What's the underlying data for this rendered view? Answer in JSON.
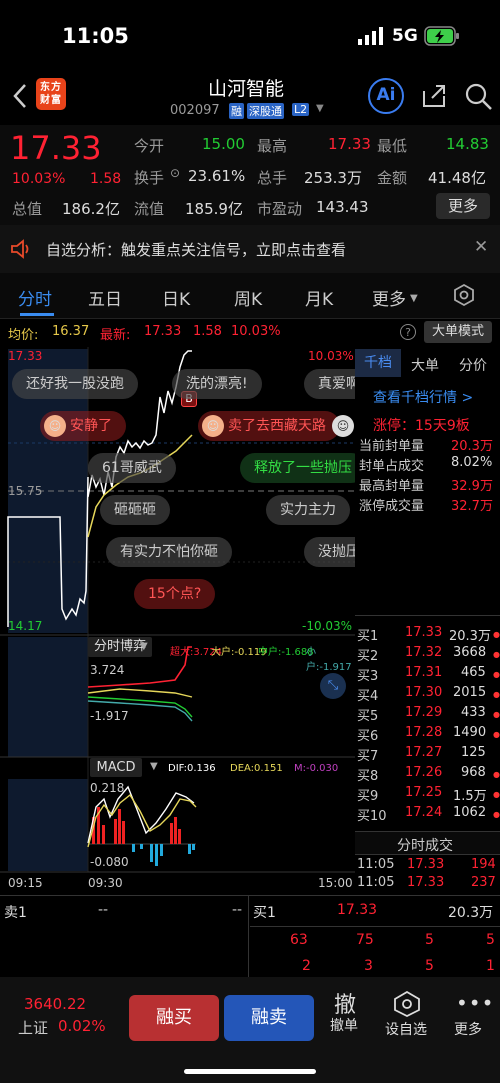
{
  "status_bar": {
    "time": "11:05",
    "network": "5G"
  },
  "header": {
    "brand_logo_text": "东方财富",
    "title": "山河智能",
    "code": "002097",
    "tags": [
      "融",
      "深股通",
      "L2"
    ],
    "ai_label": "Ai"
  },
  "quote": {
    "price": "17.33",
    "change_pct": "10.03%",
    "change_amt": "1.58",
    "fields": [
      {
        "label": "今开",
        "value": "15.00",
        "color": "#2c3"
      },
      {
        "label": "最高",
        "value": "17.33",
        "color": "#f23"
      },
      {
        "label": "最低",
        "value": "14.83",
        "color": "#2c3"
      },
      {
        "label": "换手",
        "value": "23.61%",
        "color": "#ddd"
      },
      {
        "label": "总手",
        "value": "253.3万",
        "color": "#ddd"
      },
      {
        "label": "金额",
        "value": "41.48亿",
        "color": "#ddd"
      },
      {
        "label": "总值",
        "value": "186.2亿",
        "color": "#ddd"
      },
      {
        "label": "流值",
        "value": "185.9亿",
        "color": "#ddd"
      },
      {
        "label": "市盈动",
        "value": "143.43",
        "color": "#ddd"
      }
    ],
    "more_label": "更多"
  },
  "notice": {
    "text": "自选分析：触发重点关注信号，立即点击查看"
  },
  "tabs": [
    "分时",
    "五日",
    "日K",
    "周K",
    "月K",
    "更多"
  ],
  "avg_bar": {
    "avg_label": "均价:",
    "avg_value": "16.37",
    "latest_label": "最新:",
    "latest_value": "17.33",
    "latest_change": "1.58",
    "latest_pct": "10.03%",
    "mode_button": "大单模式"
  },
  "chart": {
    "price_top": "17.33",
    "price_mid": "15.75",
    "price_bottom": "14.17",
    "pct_top": "10.03%",
    "pct_bottom": "-10.03%",
    "b_marker": "B",
    "bubbles": [
      {
        "text": "还好我一股没跑",
        "type": "gray"
      },
      {
        "text": "洗的漂亮!",
        "type": "gray"
      },
      {
        "text": "真爱啊",
        "type": "gray"
      },
      {
        "text": "安静了",
        "type": "red"
      },
      {
        "text": "卖了去西藏天路",
        "type": "red"
      },
      {
        "text": "61哥威武",
        "type": "gray"
      },
      {
        "text": "释放了一些抛压",
        "type": "green"
      },
      {
        "text": "砸砸砸",
        "type": "gray"
      },
      {
        "text": "实力主力",
        "type": "gray"
      },
      {
        "text": "有实力不怕你砸",
        "type": "gray"
      },
      {
        "text": "没抛压",
        "type": "gray"
      },
      {
        "text": "15个点?",
        "type": "red"
      }
    ],
    "game_label": "分时博弈",
    "game_legend": [
      "超大:3.724",
      "大户:-0.119",
      "中户:-1.688",
      "小户:-1.917"
    ],
    "game_top": "3.724",
    "game_bottom": "-1.917",
    "macd_label": "MACD",
    "macd_dif": "DIF:0.136",
    "macd_dea": "DEA:0.151",
    "macd_m": "M:-0.030",
    "macd_top": "0.218",
    "macd_bottom": "-0.080",
    "time_start": "09:15",
    "time_open": "09:30",
    "time_end": "15:00"
  },
  "side": {
    "tabs": [
      "千档",
      "大单",
      "分价"
    ],
    "link": "查看千档行情 >",
    "limit_up": "涨停：15天9板",
    "stats": [
      {
        "label": "当前封单量",
        "value": "20.3万"
      },
      {
        "label": "封单占成交",
        "value": "8.02%"
      },
      {
        "label": "最高封单量",
        "value": "32.9万"
      },
      {
        "label": "涨停成交量",
        "value": "32.7万"
      }
    ],
    "bids": [
      {
        "name": "买1",
        "price": "17.33",
        "vol": "20.3万"
      },
      {
        "name": "买2",
        "price": "17.32",
        "vol": "3668"
      },
      {
        "name": "买3",
        "price": "17.31",
        "vol": "465"
      },
      {
        "name": "买4",
        "price": "17.30",
        "vol": "2015"
      },
      {
        "name": "买5",
        "price": "17.29",
        "vol": "433"
      },
      {
        "name": "买6",
        "price": "17.28",
        "vol": "1490"
      },
      {
        "name": "买7",
        "price": "17.27",
        "vol": "125"
      },
      {
        "name": "买8",
        "price": "17.26",
        "vol": "968"
      },
      {
        "name": "买9",
        "price": "17.25",
        "vol": "1.5万"
      },
      {
        "name": "买10",
        "price": "17.24",
        "vol": "1062"
      }
    ],
    "trades_title": "分时成交",
    "trades": [
      {
        "time": "11:05",
        "price": "17.33",
        "vol": "194"
      },
      {
        "time": "11:05",
        "price": "17.33",
        "vol": "237"
      }
    ]
  },
  "bottom_book": {
    "sell1_label": "卖1",
    "sell1_price": "--",
    "sell1_vol": "--",
    "buy1_label": "买1",
    "buy1_price": "17.33",
    "buy1_vol": "20.3万",
    "row1": [
      "63",
      "75",
      "5",
      "5"
    ],
    "row2": [
      "2",
      "3",
      "5",
      "1"
    ]
  },
  "footer": {
    "index_value": "3640.22",
    "index_name": "上证",
    "index_pct": "0.02%",
    "buy_btn": "融买",
    "sell_btn": "融卖",
    "cancel_label": "撤单",
    "cancel_icon": "撤",
    "watch_label": "设自选",
    "more_label": "更多"
  }
}
